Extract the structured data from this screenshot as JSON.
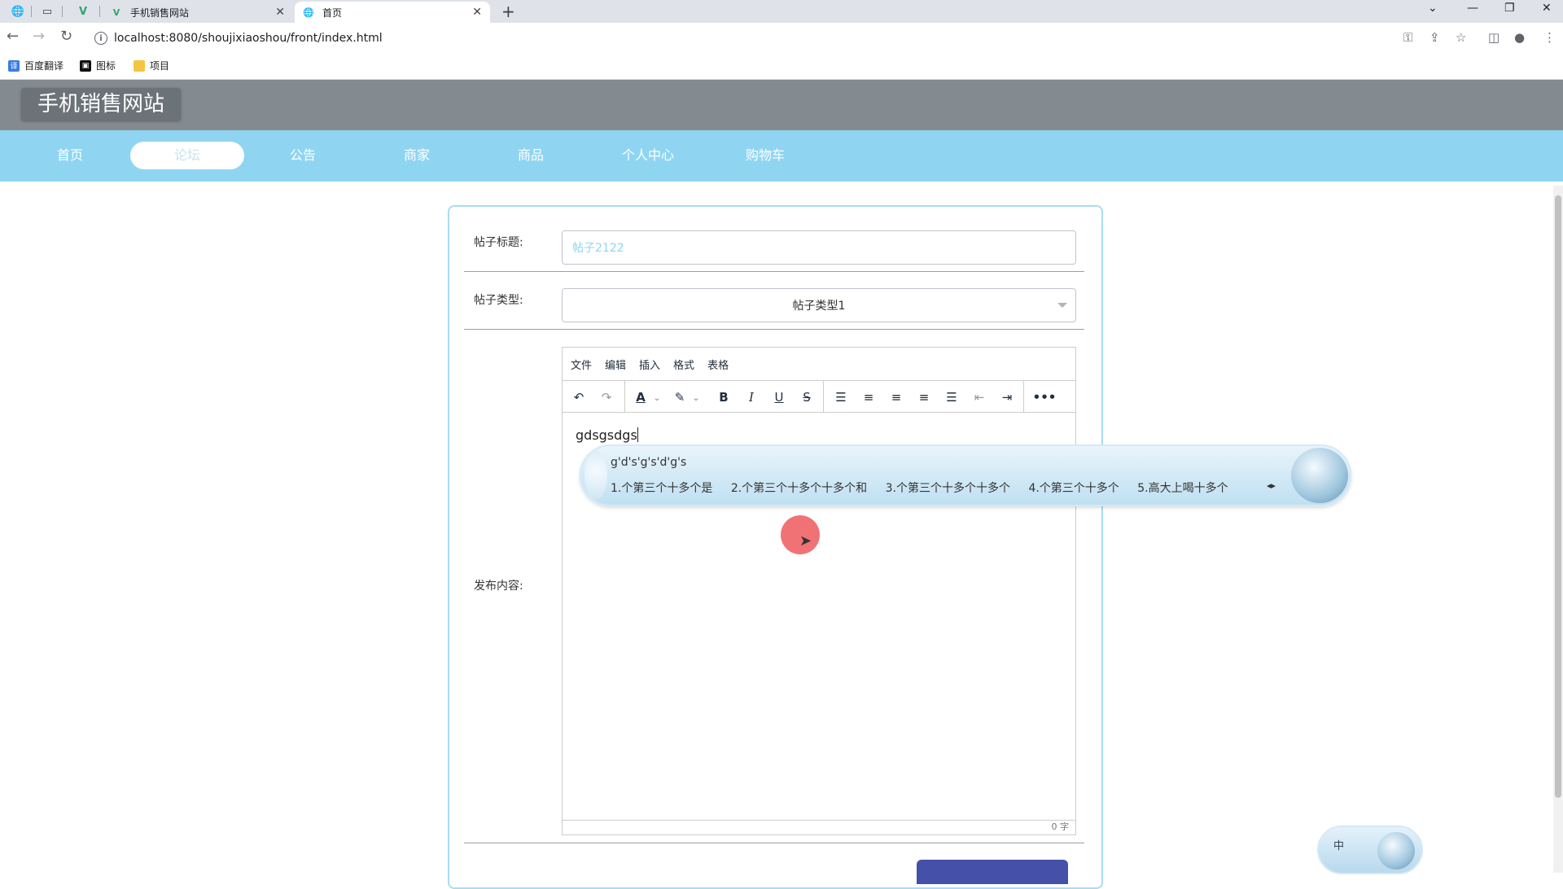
{
  "browser": {
    "tabs": [
      {
        "title": "手机销售网站"
      },
      {
        "title": "首页"
      }
    ],
    "url": "localhost:8080/shoujixiaoshou/front/index.html",
    "bookmarks": [
      {
        "label": "百度翻译"
      },
      {
        "label": "图标"
      },
      {
        "label": "项目"
      }
    ]
  },
  "site": {
    "title": "手机销售网站",
    "nav": [
      "首页",
      "论坛",
      "公告",
      "商家",
      "商品",
      "个人中心",
      "购物车"
    ],
    "active_nav": "论坛"
  },
  "form": {
    "title_label": "帖子标题:",
    "title_value": "帖子2122",
    "type_label": "帖子类型:",
    "type_value": "帖子类型1",
    "content_label": "发布内容:",
    "editor_menu": [
      "文件",
      "编辑",
      "插入",
      "格式",
      "表格"
    ],
    "editor_text": "gdsgsdgs",
    "word_count": "0 字"
  },
  "ime": {
    "composition": "g'd's'g's'd'g's",
    "candidates": [
      "1.个第三个十多个是",
      "2.个第三个十多个十多个和",
      "3.个第三个十多个十多个",
      "4.个第三个十多个",
      "5.高大上喝十多个"
    ],
    "status_label": "中"
  },
  "colors": {
    "header": "#838a90",
    "nav": "#8fd5f2",
    "card_border": "#a9dcf2",
    "submit": "#4550a8"
  }
}
